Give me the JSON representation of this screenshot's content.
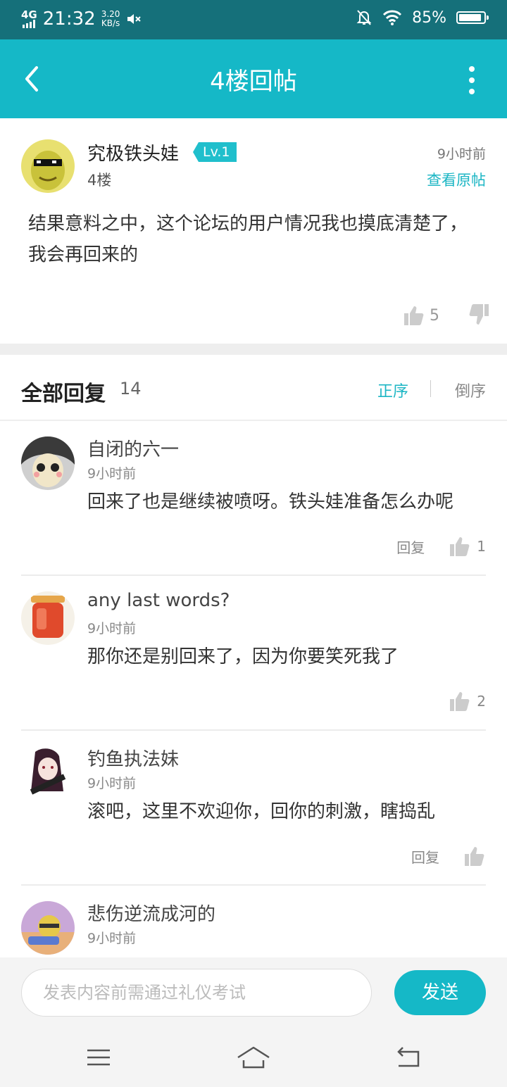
{
  "status_bar": {
    "network": "4G",
    "time": "21:32",
    "speed_value": "3.20",
    "speed_unit": "KB/s",
    "battery": "85%",
    "battery_level": 0.85
  },
  "app_bar": {
    "title": "4楼回帖"
  },
  "post": {
    "author": "究极铁头娃",
    "level": "Lv.1",
    "floor": "4楼",
    "time": "9小时前",
    "view_original": "查看原帖",
    "content": "结果意料之中，这个论坛的用户情况我也摸底清楚了，我会再回来的",
    "likes": "5"
  },
  "replies_header": {
    "label": "全部回复",
    "count": "14",
    "sort_asc": "正序",
    "sort_desc": "倒序"
  },
  "replies": [
    {
      "name": "自闭的六一",
      "time": "9小时前",
      "text": "回来了也是继续被喷呀。铁头娃准备怎么办呢",
      "reply_label": "回复",
      "likes": "1"
    },
    {
      "name": "any last words?",
      "time": "9小时前",
      "text": "那你还是别回来了，因为你要笑死我了",
      "reply_label": "",
      "likes": "2"
    },
    {
      "name": "钓鱼执法妹",
      "time": "9小时前",
      "text": "滚吧，这里不欢迎你，回你的刺激，瞎捣乱",
      "reply_label": "回复",
      "likes": ""
    },
    {
      "name": "悲伤逆流成河的",
      "time": "9小时前",
      "text": "",
      "reply_label": "",
      "likes": ""
    }
  ],
  "composer": {
    "placeholder": "发表内容前需通过礼仪考试",
    "send_label": "发送"
  },
  "colors": {
    "primary": "#15b8c7",
    "status_bar": "#15707a"
  }
}
